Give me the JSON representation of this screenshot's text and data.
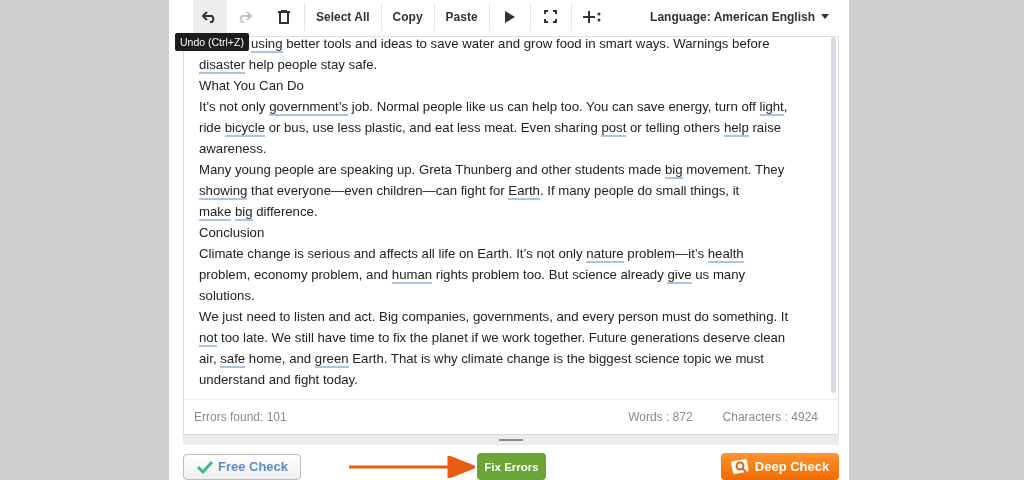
{
  "toolbar": {
    "items": [
      {
        "kind": "undo",
        "selected": true,
        "disabled": false
      },
      {
        "kind": "redo",
        "selected": false,
        "disabled": true
      },
      {
        "kind": "delete",
        "selected": false,
        "disabled": false
      },
      {
        "kind": "text",
        "label": "Select All",
        "selected": false,
        "disabled": false
      },
      {
        "kind": "text",
        "label": "Copy",
        "selected": false,
        "disabled": false
      },
      {
        "kind": "text",
        "label": "Paste",
        "selected": false,
        "disabled": false
      },
      {
        "kind": "play",
        "selected": false,
        "disabled": false
      },
      {
        "kind": "fullscreen",
        "selected": false,
        "disabled": false
      },
      {
        "kind": "insert",
        "selected": false,
        "disabled": false
      }
    ],
    "language": "Language: American English"
  },
  "tooltip": "Undo (Ctrl+Z)",
  "paragraphs": [
    [
      {
        "t": "using",
        "error": true
      },
      {
        "t": " better tools and ideas to save water and grow food in smart ways. Warnings before ",
        "error": false
      },
      {
        "t": "disaster",
        "error": true
      },
      {
        "t": " help people stay safe.",
        "error": false
      }
    ],
    [
      {
        "t": "What You Can Do",
        "error": false
      }
    ],
    [
      {
        "t": "It’s not only ",
        "error": false
      },
      {
        "t": "government’s",
        "error": true
      },
      {
        "t": " job. Normal people like us can help too. You can save energy, turn off ",
        "error": false
      },
      {
        "t": "light",
        "error": true
      },
      {
        "t": ", ride ",
        "error": false
      },
      {
        "t": "bicycle",
        "error": true
      },
      {
        "t": " or bus, use less plastic, and eat less meat. Even sharing ",
        "error": false
      },
      {
        "t": "post",
        "error": true
      },
      {
        "t": " or telling others ",
        "error": false
      },
      {
        "t": "help",
        "error": true
      },
      {
        "t": " raise awareness.",
        "error": false
      }
    ],
    [
      {
        "t": "Many young people are speaking up. Greta Thunberg and other students made ",
        "error": false
      },
      {
        "t": "big",
        "error": true
      },
      {
        "t": " movement. They ",
        "error": false
      },
      {
        "t": "showing",
        "error": true
      },
      {
        "t": " that everyone—even children—can fight for ",
        "error": false
      },
      {
        "t": "Earth",
        "error": true
      },
      {
        "t": ". If many people do small things, it ",
        "error": false
      },
      {
        "t": "make",
        "error": true
      },
      {
        "t": "big",
        "error": true
      },
      {
        "t": " difference.",
        "error": false
      }
    ],
    [
      {
        "t": "Conclusion",
        "error": false
      }
    ],
    [
      {
        "t": "Climate change is serious and affects all life on Earth. It’s not only ",
        "error": false
      },
      {
        "t": "nature",
        "error": true
      },
      {
        "t": " problem—it’s ",
        "error": false
      },
      {
        "t": "health",
        "error": true
      },
      {
        "t": " problem, economy problem, and ",
        "error": false
      },
      {
        "t": "human",
        "error": true
      },
      {
        "t": " rights problem too. But science already ",
        "error": false
      },
      {
        "t": "give",
        "error": true
      },
      {
        "t": " us many solutions.",
        "error": false
      }
    ],
    [
      {
        "t": "We just need to listen and act. Big companies, governments, and every person must do something. It ",
        "error": false
      },
      {
        "t": "not",
        "error": true
      },
      {
        "t": " too late. We still have time to fix the planet if we work together. Future generations deserve clean air, ",
        "error": false
      },
      {
        "t": "safe",
        "error": true
      },
      {
        "t": " home, and ",
        "error": false
      },
      {
        "t": "green",
        "error": true
      },
      {
        "t": " Earth. That is why climate change is the biggest science topic we must understand and fight today.",
        "error": false
      }
    ]
  ],
  "status": {
    "errors": "Errors found: 101",
    "words": "Words : 872",
    "characters": "Characters : 4924"
  },
  "buttons": [
    {
      "kind": "free",
      "label": "Free Check"
    },
    {
      "kind": "fix",
      "label": "Fix Errors"
    },
    {
      "kind": "deep",
      "label": "Deep Check"
    }
  ]
}
